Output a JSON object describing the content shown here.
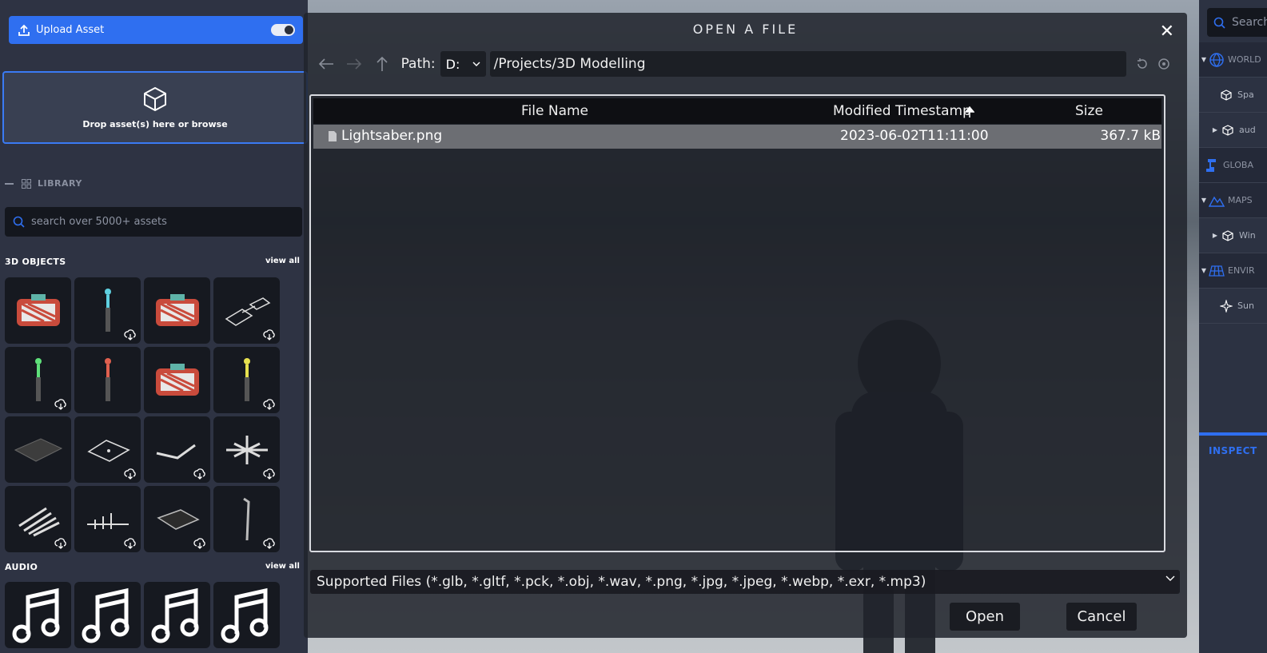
{
  "left_panel": {
    "upload_label": "Upload Asset",
    "drop_text": "Drop asset(s) here or browse",
    "library_label": "LIBRARY",
    "search_placeholder": "search over 5000+ assets",
    "sections": {
      "objects_title": "3D OBJECTS",
      "objects_view_all": "view all",
      "audio_title": "AUDIO",
      "audio_view_all": "view all"
    }
  },
  "dialog": {
    "title": "OPEN A FILE",
    "path_label": "Path:",
    "drive": "D:",
    "path": "/Projects/3D Modelling",
    "columns": {
      "name": "File Name",
      "modified": "Modified Timestamp",
      "size": "Size"
    },
    "files": [
      {
        "name": "Lightsaber.png",
        "modified": "2023-06-02T11:11:00",
        "size": "367.7 kB"
      }
    ],
    "filter": "Supported Files (*.glb, *.gltf, *.pck, *.obj, *.wav, *.png, *.jpg, *.jpeg, *.webp, *.exr, *.mp3)",
    "open_label": "Open",
    "cancel_label": "Cancel"
  },
  "right_panel": {
    "search_placeholder": "Search",
    "tree": [
      {
        "label": "WORLD"
      },
      {
        "label": "Spa"
      },
      {
        "label": "aud"
      },
      {
        "label": "GLOBA"
      },
      {
        "label": "MAPS"
      },
      {
        "label": "Win"
      },
      {
        "label": "ENVIR"
      },
      {
        "label": "Sun"
      }
    ],
    "inspector_label": "INSPECT"
  },
  "colors": {
    "accent": "#2f6ff0",
    "panel": "#2e3343",
    "dialog": "#21242c"
  }
}
